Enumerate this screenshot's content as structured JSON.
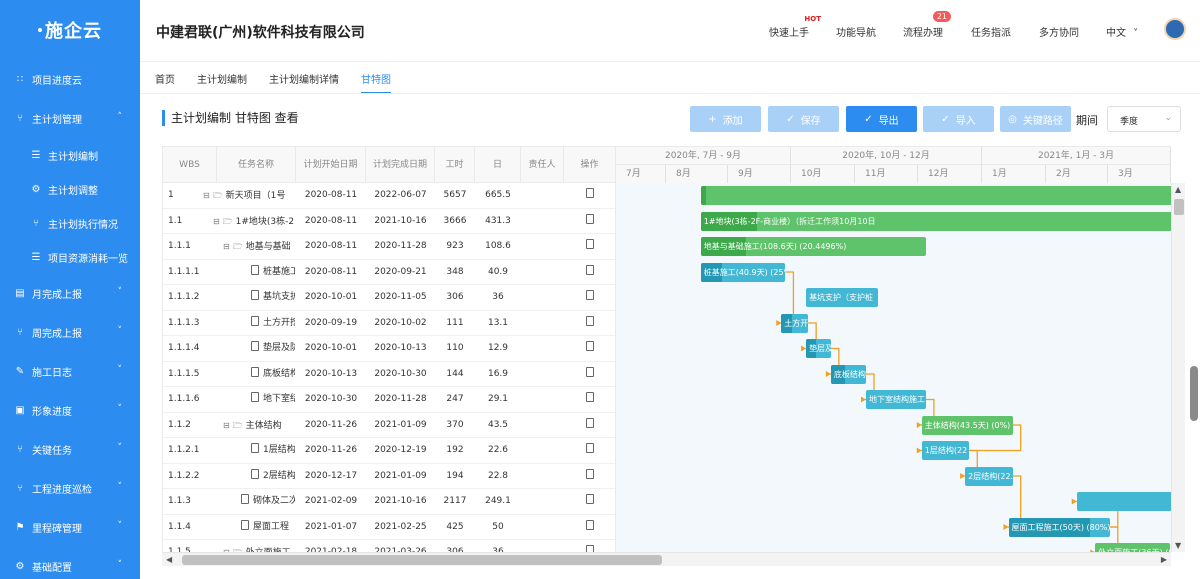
{
  "app": {
    "logo": "施企云",
    "company": "中建君联(广州)软件科技有限公司"
  },
  "sidebar": {
    "items": [
      {
        "label": "项目进度云",
        "icon": "grid-icon"
      },
      {
        "label": "主计划管理",
        "icon": "hierarchy-icon",
        "expanded": true
      },
      {
        "label": "主计划编制",
        "icon": "document-icon"
      },
      {
        "label": "主计划调整",
        "icon": "adjust-icon"
      },
      {
        "label": "主计划执行情况",
        "icon": "hierarchy-icon"
      },
      {
        "label": "项目资源消耗一览",
        "icon": "document-icon"
      },
      {
        "label": "月完成上报",
        "icon": "calendar-icon"
      },
      {
        "label": "周完成上报",
        "icon": "hierarchy-icon"
      },
      {
        "label": "施工日志",
        "icon": "log-icon"
      },
      {
        "label": "形象进度",
        "icon": "image-icon"
      },
      {
        "label": "关键任务",
        "icon": "hierarchy-icon"
      },
      {
        "label": "工程进度巡检",
        "icon": "hierarchy-icon"
      },
      {
        "label": "里程碑管理",
        "icon": "milestone-icon"
      },
      {
        "label": "基础配置",
        "icon": "settings-icon"
      }
    ]
  },
  "header": {
    "nav": [
      {
        "label": "快速上手",
        "hot": "HOT"
      },
      {
        "label": "功能导航"
      },
      {
        "label": "流程办理",
        "badge": "21"
      },
      {
        "label": "任务指派"
      },
      {
        "label": "多方协同"
      },
      {
        "label": "中文"
      }
    ]
  },
  "tabs": [
    "首页",
    "主计划编制",
    "主计划编制详情",
    "甘特图"
  ],
  "toolbar": {
    "title": "主计划编制 甘特图 查看",
    "buttons": [
      {
        "label": "添加",
        "icon": "plus-icon",
        "disabled": true
      },
      {
        "label": "保存",
        "icon": "check-circle-icon",
        "disabled": true
      },
      {
        "label": "导出",
        "icon": "check-circle-icon",
        "disabled": false
      },
      {
        "label": "导入",
        "icon": "check-circle-icon",
        "disabled": true
      },
      {
        "label": "关键路径",
        "icon": "target-icon",
        "disabled": true
      }
    ],
    "period_label": "期间",
    "period_value": "季度"
  },
  "grid": {
    "columns": [
      "WBS",
      "任务名称",
      "计划开始日期",
      "计划完成日期",
      "工时",
      "日",
      "责任人",
      "操作"
    ],
    "rows": [
      {
        "wbs": "1",
        "name": "新天项目（1号",
        "start": "2020-08-11",
        "end": "2022-06-07",
        "hours": "5657",
        "days": "665.5",
        "level": 0,
        "type": "folder"
      },
      {
        "wbs": "1.1",
        "name": "1#地块(3栋-2",
        "start": "2020-08-11",
        "end": "2021-10-16",
        "hours": "3666",
        "days": "431.3",
        "level": 1,
        "type": "folder"
      },
      {
        "wbs": "1.1.1",
        "name": "地基与基础",
        "start": "2020-08-11",
        "end": "2020-11-28",
        "hours": "923",
        "days": "108.6",
        "level": 2,
        "type": "folder"
      },
      {
        "wbs": "1.1.1.1",
        "name": "桩基施工",
        "start": "2020-08-11",
        "end": "2020-09-21",
        "hours": "348",
        "days": "40.9",
        "level": 3,
        "type": "file"
      },
      {
        "wbs": "1.1.1.2",
        "name": "基坑支护",
        "start": "2020-10-01",
        "end": "2020-11-05",
        "hours": "306",
        "days": "36",
        "level": 3,
        "type": "file"
      },
      {
        "wbs": "1.1.1.3",
        "name": "土方开挖",
        "start": "2020-09-19",
        "end": "2020-10-02",
        "hours": "111",
        "days": "13.1",
        "level": 3,
        "type": "file"
      },
      {
        "wbs": "1.1.1.4",
        "name": "垫层及防",
        "start": "2020-10-01",
        "end": "2020-10-13",
        "hours": "110",
        "days": "12.9",
        "level": 3,
        "type": "file"
      },
      {
        "wbs": "1.1.1.5",
        "name": "底板结构",
        "start": "2020-10-13",
        "end": "2020-10-30",
        "hours": "144",
        "days": "16.9",
        "level": 3,
        "type": "file"
      },
      {
        "wbs": "1.1.1.6",
        "name": "地下室结",
        "start": "2020-10-30",
        "end": "2020-11-28",
        "hours": "247",
        "days": "29.1",
        "level": 3,
        "type": "file"
      },
      {
        "wbs": "1.1.2",
        "name": "主体结构",
        "start": "2020-11-26",
        "end": "2021-01-09",
        "hours": "370",
        "days": "43.5",
        "level": 2,
        "type": "folder"
      },
      {
        "wbs": "1.1.2.1",
        "name": "1层结构",
        "start": "2020-11-26",
        "end": "2020-12-19",
        "hours": "192",
        "days": "22.6",
        "level": 3,
        "type": "file"
      },
      {
        "wbs": "1.1.2.2",
        "name": "2层结构",
        "start": "2020-12-17",
        "end": "2021-01-09",
        "hours": "194",
        "days": "22.8",
        "level": 3,
        "type": "file"
      },
      {
        "wbs": "1.1.3",
        "name": "砌体及二次",
        "start": "2021-02-09",
        "end": "2021-10-16",
        "hours": "2117",
        "days": "249.1",
        "level": 2,
        "type": "file"
      },
      {
        "wbs": "1.1.4",
        "name": "屋面工程",
        "start": "2021-01-07",
        "end": "2021-02-25",
        "hours": "425",
        "days": "50",
        "level": 2,
        "type": "file"
      },
      {
        "wbs": "1.1.5",
        "name": "外立面施工",
        "start": "2021-02-18",
        "end": "2021-03-26",
        "hours": "306",
        "days": "36",
        "level": 2,
        "type": "folder"
      }
    ]
  },
  "gantt": {
    "quarters": [
      "2020年, 7月 - 9月",
      "2020年, 10月 - 12月",
      "2021年, 1月 - 3月"
    ],
    "months": [
      "7月",
      "8月",
      "9月",
      "10月",
      "11月",
      "12月",
      "1月",
      "2月",
      "3月"
    ],
    "bars": [
      {
        "row": 0,
        "label": "",
        "start": "2020-08-11",
        "end": "2022-06-07",
        "progress": 0.01,
        "color": "green"
      },
      {
        "row": 1,
        "label": "1#地块(3栋-2F-商业楼）（拆迁工作须10月10日",
        "start": "2020-08-11",
        "end": "2021-10-16",
        "progress": 0.11,
        "color": "green"
      },
      {
        "row": 2,
        "label": "地基与基础施工(108.6天) (20.4496%)",
        "start": "2020-08-11",
        "end": "2020-11-28",
        "progress": 0.2,
        "color": "green"
      },
      {
        "row": 3,
        "label": "桩基施工(40.9天) (25%",
        "start": "2020-08-11",
        "end": "2020-09-21",
        "progress": 0.25,
        "color": "teal"
      },
      {
        "row": 4,
        "label": "基坑支护（支护桩",
        "start": "2020-10-01",
        "end": "2020-11-05",
        "progress": 0,
        "color": "teal"
      },
      {
        "row": 5,
        "label": "土方开",
        "start": "2020-09-19",
        "end": "2020-10-02",
        "progress": 0.4,
        "color": "teal"
      },
      {
        "row": 6,
        "label": "垫层及",
        "start": "2020-10-01",
        "end": "2020-10-13",
        "progress": 0.4,
        "color": "teal"
      },
      {
        "row": 7,
        "label": "底板结构",
        "start": "2020-10-13",
        "end": "2020-10-30",
        "progress": 0.4,
        "color": "teal"
      },
      {
        "row": 8,
        "label": "地下室结构施工",
        "start": "2020-10-30",
        "end": "2020-11-28",
        "progress": 0,
        "color": "teal"
      },
      {
        "row": 9,
        "label": "主体结构(43.5天) (0%)",
        "start": "2020-11-26",
        "end": "2021-01-09",
        "progress": 0,
        "color": "green"
      },
      {
        "row": 10,
        "label": "1层结构(22",
        "start": "2020-11-26",
        "end": "2020-12-19",
        "progress": 0,
        "color": "teal"
      },
      {
        "row": 11,
        "label": "2层结构(22.",
        "start": "2020-12-17",
        "end": "2021-01-09",
        "progress": 0,
        "color": "teal"
      },
      {
        "row": 12,
        "label": "",
        "start": "2021-02-09",
        "end": "2021-10-16",
        "progress": 0,
        "color": "teal"
      },
      {
        "row": 13,
        "label": "屋面工程施工(50天) (80%)",
        "start": "2021-01-07",
        "end": "2021-02-25",
        "progress": 0.8,
        "color": "teal"
      },
      {
        "row": 14,
        "label": "外立面施工(36天) (0",
        "start": "2021-02-18",
        "end": "2021-03-26",
        "progress": 0,
        "color": "green"
      }
    ],
    "links": [
      [
        3,
        5
      ],
      [
        5,
        6
      ],
      [
        6,
        7
      ],
      [
        7,
        8
      ],
      [
        8,
        9
      ],
      [
        9,
        10
      ],
      [
        10,
        11
      ],
      [
        11,
        13
      ],
      [
        13,
        12
      ],
      [
        13,
        14
      ]
    ],
    "colors": {
      "green": "#5ec36a",
      "teal": "#42b8d4",
      "link": "#f0a020"
    }
  }
}
